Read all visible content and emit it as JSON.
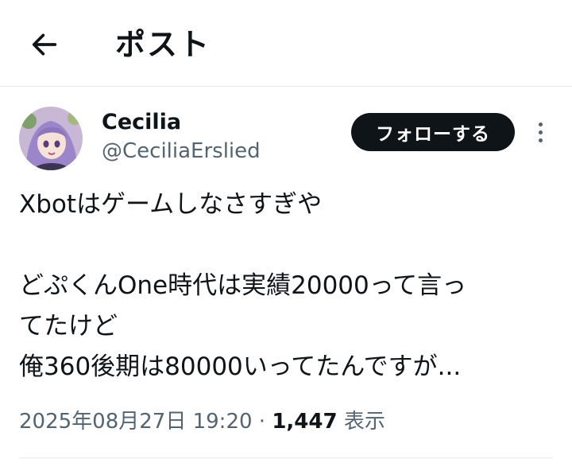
{
  "header": {
    "back_icon": "arrow-left-icon",
    "title": "ポスト"
  },
  "author": {
    "display_name": "Cecilia",
    "handle": "@CeciliaErslied",
    "avatar_icon": "avatar-image"
  },
  "follow_button": {
    "label": "フォローする"
  },
  "more_icon": "more-vertical-icon",
  "tweet": {
    "lines": [
      "Xbotはゲームしなさすぎや",
      "",
      "どぷくんOne時代は実績20000って言っ",
      "てたけど",
      "俺360後期は80000いってたんですが..."
    ]
  },
  "meta": {
    "timestamp": "2025年08月27日 19:20",
    "separator": "·",
    "view_count": "1,447",
    "view_label": "表示"
  },
  "colors": {
    "text_primary": "#0f1419",
    "text_secondary": "#536471",
    "follow_bg": "#0f1419",
    "divider": "#e6e9eb"
  }
}
